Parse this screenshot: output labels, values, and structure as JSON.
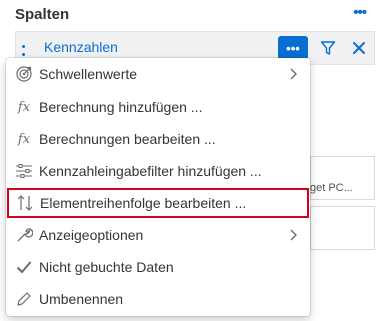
{
  "header": {
    "title": "Spalten",
    "more_glyph": "•••"
  },
  "panel": {
    "label": "Kennzahlen",
    "more_button_glyph": "•••",
    "accent_color": "#0a6ed1"
  },
  "background": {
    "partial_text": "get PC..."
  },
  "menu": {
    "items": [
      {
        "label": "Schwellenwerte",
        "icon": "threshold-icon",
        "submenu": true
      },
      {
        "label": "Berechnung hinzufügen ...",
        "icon": "fx-icon",
        "submenu": false
      },
      {
        "label": "Berechnungen bearbeiten ...",
        "icon": "fx-icon",
        "submenu": false
      },
      {
        "label": "Kennzahleingabefilter hinzufügen ...",
        "icon": "filter-sliders-icon",
        "submenu": false
      },
      {
        "label": "Elementreihenfolge bearbeiten ...",
        "icon": "sort-icon",
        "submenu": false,
        "highlighted": true
      },
      {
        "label": "Anzeigeoptionen",
        "icon": "wrench-icon",
        "submenu": true
      },
      {
        "label": "Nicht gebuchte Daten",
        "icon": "checkmark-icon",
        "submenu": false
      },
      {
        "label": "Umbenennen",
        "icon": "pencil-icon",
        "submenu": false
      }
    ],
    "highlight_color": "#d0021b"
  }
}
